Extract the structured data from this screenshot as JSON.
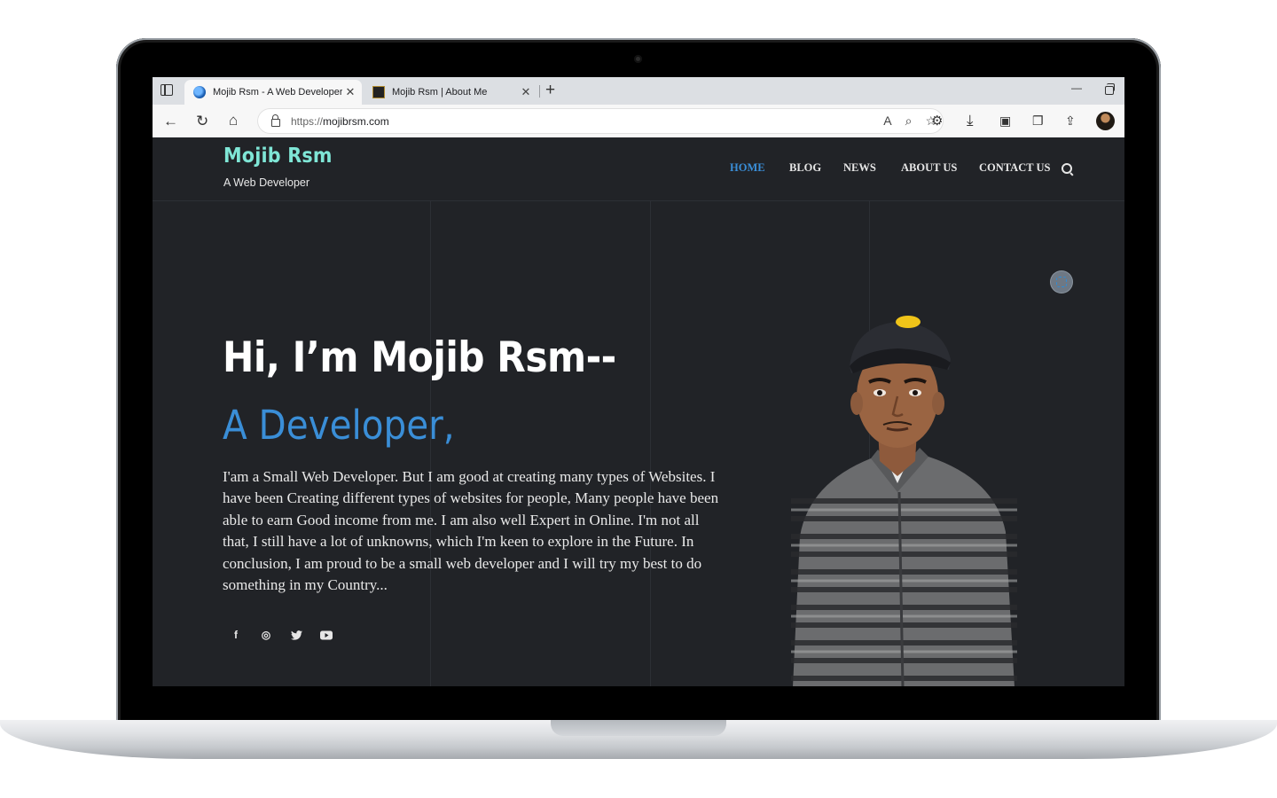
{
  "browser": {
    "tabs": [
      {
        "title": "Mojib Rsm - A Web Developer",
        "active": true
      },
      {
        "title": "Mojib Rsm | About Me",
        "active": false
      }
    ],
    "address": {
      "scheme": "https://",
      "host": "mojibrsm.com"
    }
  },
  "site": {
    "title": "Mojib Rsm",
    "tagline": "A Web Developer",
    "nav": [
      {
        "label": "HOME",
        "active": true
      },
      {
        "label": "BLOG",
        "active": false
      },
      {
        "label": "NEWS",
        "active": false
      },
      {
        "label": "ABOUT US",
        "active": false
      },
      {
        "label": "CONTACT US",
        "active": false
      }
    ],
    "hero": {
      "heading": "Hi, I’m Mojib Rsm--",
      "subheading": "A Developer,",
      "paragraph": "I'am a Small Web Developer. But I am good at creating many types of Websites. I have been Creating different types of websites for people, Many people have been able to earn Good income from me. I am also well Expert in Online. I'm not all that, I still have a lot of unknowns, which I'm keen to explore in the Future. In conclusion, I am proud to be a small web developer and I will try my best to do something in my Country..."
    },
    "socials": [
      {
        "icon": "facebook-icon",
        "glyph": "f"
      },
      {
        "icon": "instagram-icon",
        "glyph": "◎"
      },
      {
        "icon": "twitter-icon",
        "glyph": "🐦"
      },
      {
        "icon": "youtube-icon",
        "glyph": "▶"
      }
    ]
  },
  "colors": {
    "background": "#212327",
    "accent": "#3a8ed7",
    "site_title": "#7fe6d6"
  }
}
